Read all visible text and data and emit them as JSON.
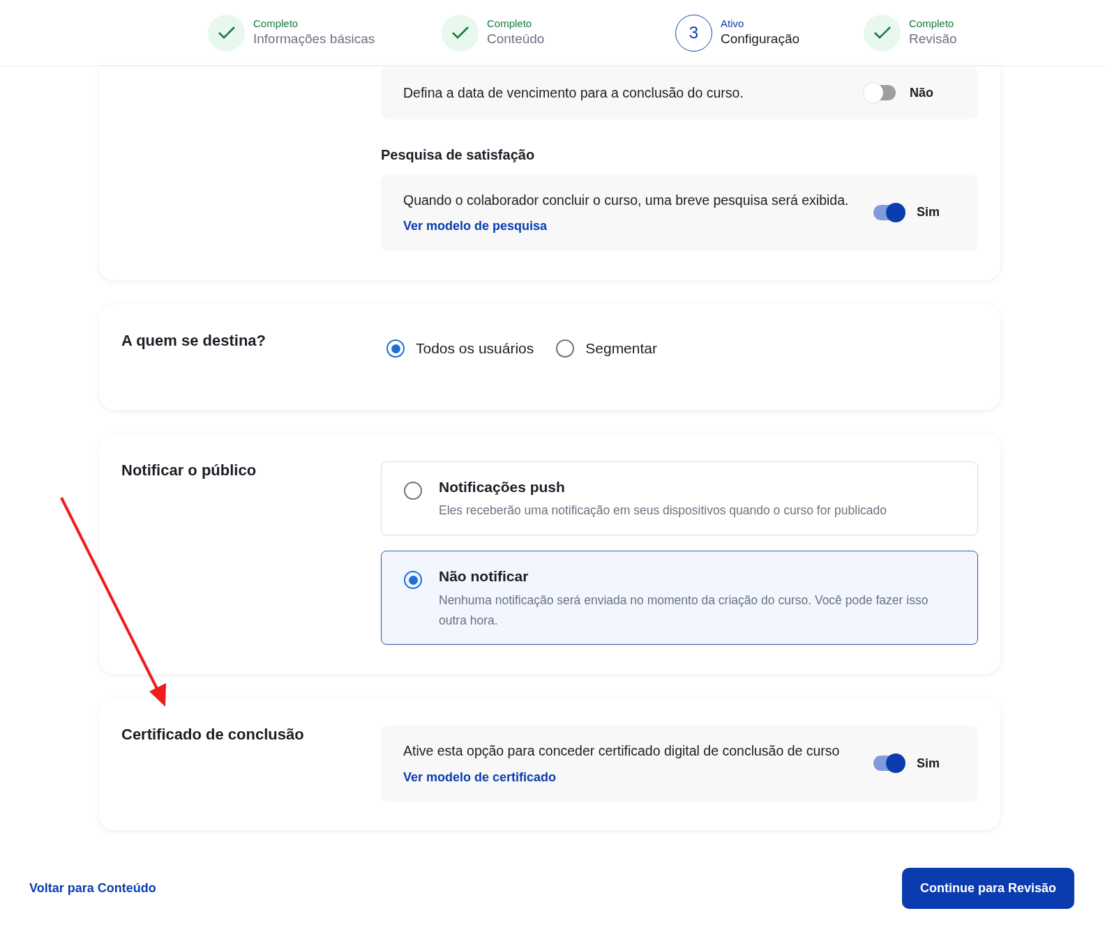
{
  "steps": [
    {
      "kind": "complete",
      "status": "Completo",
      "title": "Informações básicas"
    },
    {
      "kind": "complete",
      "status": "Completo",
      "title": "Conteúdo"
    },
    {
      "kind": "active",
      "number": "3",
      "status": "Ativo",
      "title": "Configuração"
    },
    {
      "kind": "complete",
      "status": "Completo",
      "title": "Revisão"
    }
  ],
  "settings": {
    "due_date": {
      "text": "Defina a data de vencimento para a conclusão do curso.",
      "on": false,
      "toggle_label": "Não"
    },
    "survey": {
      "heading": "Pesquisa de satisfação",
      "text": "Quando o colaborador concluir o curso, uma breve pesquisa será exibida.",
      "link": "Ver modelo de pesquisa",
      "on": true,
      "toggle_label": "Sim"
    }
  },
  "audience": {
    "title": "A quem se destina?",
    "options": [
      {
        "label": "Todos os usuários",
        "selected": true
      },
      {
        "label": "Segmentar",
        "selected": false
      }
    ]
  },
  "notify": {
    "title": "Notificar o público",
    "options": [
      {
        "title": "Notificações push",
        "description": "Eles receberão uma notificação em seus dispositivos quando o curso for publicado",
        "selected": false
      },
      {
        "title": "Não notificar",
        "description": "Nenhuma notificação será enviada no momento da criação do curso. Você pode fazer isso outra hora.",
        "selected": true
      }
    ]
  },
  "certificate": {
    "title": "Certificado de conclusão",
    "text": "Ative esta opção para conceder certificado digital de conclusão de curso",
    "link": "Ver modelo de certificado",
    "on": true,
    "toggle_label": "Sim"
  },
  "footer": {
    "back_link": "Voltar para Conteúdo",
    "continue_button": "Continue para Revisão"
  }
}
